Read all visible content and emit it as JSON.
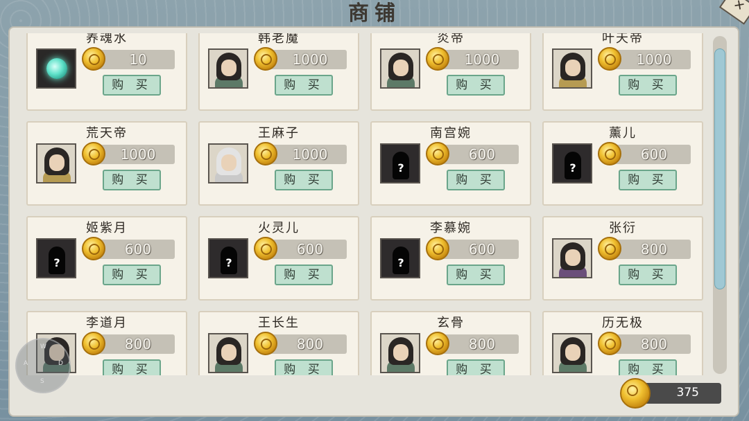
{
  "title": "商铺",
  "close_icon": "brush-close-icon",
  "buy_label": "购 买",
  "colors": {
    "panel": "#e6e4dc",
    "card": "#f6f2e8",
    "buy_button": "#bfe0cf",
    "price_box": "#c5c1b6",
    "coin": "#f0c030",
    "scrollbar": "#9fc8d4"
  },
  "items": [
    {
      "name": "养魂水",
      "price": "10",
      "portrait": "potion"
    },
    {
      "name": "韩老魔",
      "price": "1000",
      "portrait": "hero"
    },
    {
      "name": "炎帝",
      "price": "1000",
      "portrait": "hero"
    },
    {
      "name": "叶天帝",
      "price": "1000",
      "portrait": "hero-gold"
    },
    {
      "name": "荒天帝",
      "price": "1000",
      "portrait": "hero-gold"
    },
    {
      "name": "王麻子",
      "price": "1000",
      "portrait": "white-hair"
    },
    {
      "name": "南宫婉",
      "price": "600",
      "portrait": "locked"
    },
    {
      "name": "薰儿",
      "price": "600",
      "portrait": "locked"
    },
    {
      "name": "姬紫月",
      "price": "600",
      "portrait": "locked"
    },
    {
      "name": "火灵儿",
      "price": "600",
      "portrait": "locked"
    },
    {
      "name": "李慕婉",
      "price": "600",
      "portrait": "locked"
    },
    {
      "name": "张衍",
      "price": "800",
      "portrait": "hero-purple"
    },
    {
      "name": "李道月",
      "price": "800",
      "portrait": "hero"
    },
    {
      "name": "王长生",
      "price": "800",
      "portrait": "hero"
    },
    {
      "name": "玄骨",
      "price": "800",
      "portrait": "hero"
    },
    {
      "name": "历无极",
      "price": "800",
      "portrait": "hero"
    }
  ],
  "locked_mark": "?",
  "wallet": {
    "amount": "375",
    "icon": "gold-coin-icon"
  },
  "compass": {
    "n": "W",
    "w": "A",
    "e": "D",
    "s": "S"
  }
}
